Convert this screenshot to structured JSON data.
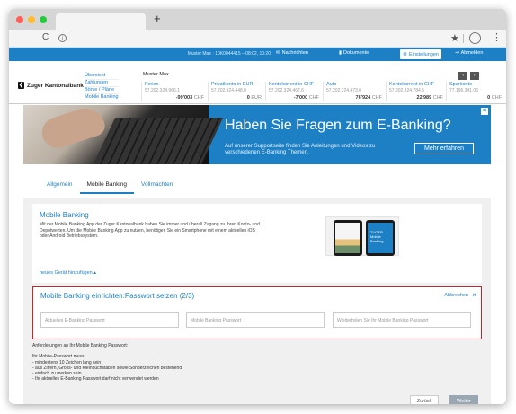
{
  "colors": {
    "brand": "#1d80c5",
    "alert_border": "#c6252b",
    "disabled_button": "#9aa7b2"
  },
  "browser": {
    "new_tab": "+",
    "reload": "C",
    "info": "i",
    "star": "★",
    "menu": "⋮"
  },
  "topbar": {
    "user": "Muster Max · 10K0044415 – 08:02, 10:20",
    "messages": "Nachrichten",
    "documents": "Dokumente",
    "settings": "Einstellungen",
    "logout": "Abmelden"
  },
  "nav": {
    "logo": "Zuger Kantonalbank",
    "links": [
      "Übersicht",
      "Zahlungen",
      "Börse / Pläne",
      "Mobile Banking"
    ],
    "owner": "Muster Max",
    "accounts": [
      {
        "name": "Ferien",
        "iban": "57.202.324.966.1",
        "balance": "-99'003",
        "currency": "CHF"
      },
      {
        "name": "Privatkonto in EUR",
        "iban": "57.202.324.448.0",
        "balance": "0",
        "currency": "EUR"
      },
      {
        "name": "Kontokorrent in CHF",
        "iban": "57.202.324.467.6",
        "balance": "-7'000",
        "currency": "CHF"
      },
      {
        "name": "Auto",
        "iban": "57.202.324.473.0",
        "balance": "76'924",
        "currency": "CHF"
      },
      {
        "name": "Kontokorrent in CHF",
        "iban": "57.202.324.784.5",
        "balance": "22'989",
        "currency": "CHF"
      },
      {
        "name": "Sparkonto",
        "iban": "77.196.341.06",
        "balance": "0",
        "currency": "CHF"
      }
    ]
  },
  "banner": {
    "headline": "Haben Sie Fragen zum E-Banking?",
    "sub": "Auf unserer Supportseite finden Sie Anleitungen und Videos zu verschiedenen E-Banking Themen.",
    "button": "Mehr erfahren",
    "close": "×"
  },
  "tabs": [
    "Allgemein",
    "Mobile Banking",
    "Vollmachten"
  ],
  "mobile_card": {
    "title": "Mobile Banking",
    "text": "Mit der Mobile Banking App der Zuger Kantonalbank haben Sie immer und überall Zugang zu Ihren Konto- und Depotwerten. Um die Mobile Banking App zu nutzen, benötigen Sie ein Smartphone mit einem aktuellen iOS oder Android Betriebssystem.",
    "add_device": "neues Gerät hinzufügen ▴",
    "phone_label": "ZUGER Mobile Banking"
  },
  "setup_card": {
    "title": "Mobile Banking einrichten:Passwort setzen (2/3)",
    "cancel": "Abbrechen",
    "close": "×",
    "placeholders": [
      "Aktuelles E-Banking Passwort",
      "Mobile Banking Passwort",
      "Wiederholen Sie Ihr Mobile Banking Passwort"
    ]
  },
  "requirements": [
    "Anforderungen an Ihr Mobile Banking Passwort:",
    "",
    "Ihr Mobile-Passwort muss:",
    "- mindestens 10 Zeichen lang sein",
    "- aus Ziffern, Gross- und Kleinbuchstaben sowie Sonderzeichen bestehend",
    "- einfach zu merken sein",
    "- Ihr aktuelles E-Banking Passwort darf nicht verwendet werden"
  ],
  "buttons": {
    "back": "Zurück",
    "next": "Weiter"
  }
}
